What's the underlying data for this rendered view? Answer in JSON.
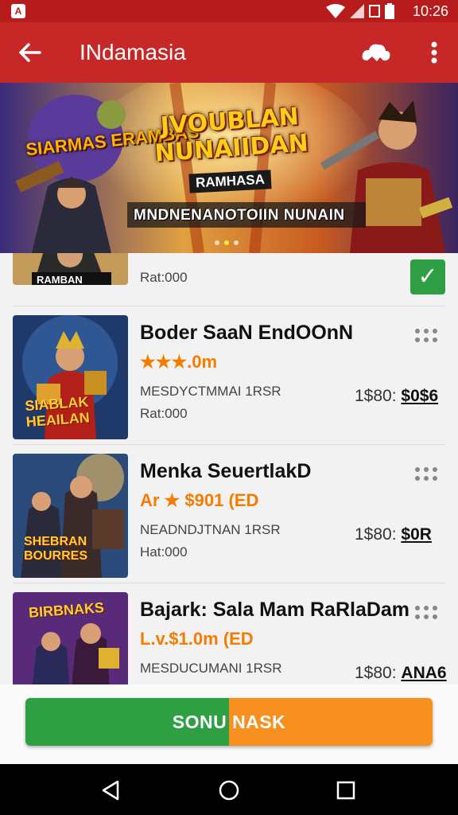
{
  "status_bar": {
    "time": "10:26"
  },
  "app_bar": {
    "title": "INdamasia"
  },
  "banner": {
    "title": "JVOUBLAN NUNAIIDAN",
    "subtitle": "RAMHASA",
    "strip_text": "MNDNENANOTOIIN NUNAIN",
    "left_text": "SIARMAS ERAMBAS",
    "slide_count": 3,
    "active_slide": 2
  },
  "items": [
    {
      "rate": "Rat:000",
      "thumb_label": "RAMBAN",
      "selected": true
    },
    {
      "name": "Boder SaaN EndOOnN",
      "rating": "★★★.0m",
      "meta": "MESDYCTMMAI 1RSR",
      "rate": "Rat:000",
      "price_prefix": "1$80:",
      "price_value": "$0$6",
      "thumb_label": "SIABLAK HEAILAN"
    },
    {
      "name": "Menka SeuertlakD",
      "rating": "Ar ★ $901 (ED",
      "meta": "NEADNDJTNAN 1RSR",
      "rate": "Hat:000",
      "price_prefix": "1$80:",
      "price_value": "$0R",
      "thumb_label": "SHEBRAN BOURRES"
    },
    {
      "name": "Bajark: Sala Mam RaRlaDam",
      "rating": "L.v.$1.0m (ED",
      "meta": "MESDUCUMANI 1RSR",
      "price_prefix": "1$80:",
      "price_value": "ANA6",
      "thumb_label": "BIRBNAKS"
    }
  ],
  "cta": {
    "label": "SONU NASK"
  },
  "colors": {
    "primary": "#c62828",
    "status": "#b71c1c",
    "green": "#2ea043",
    "orange": "#f7901e"
  }
}
